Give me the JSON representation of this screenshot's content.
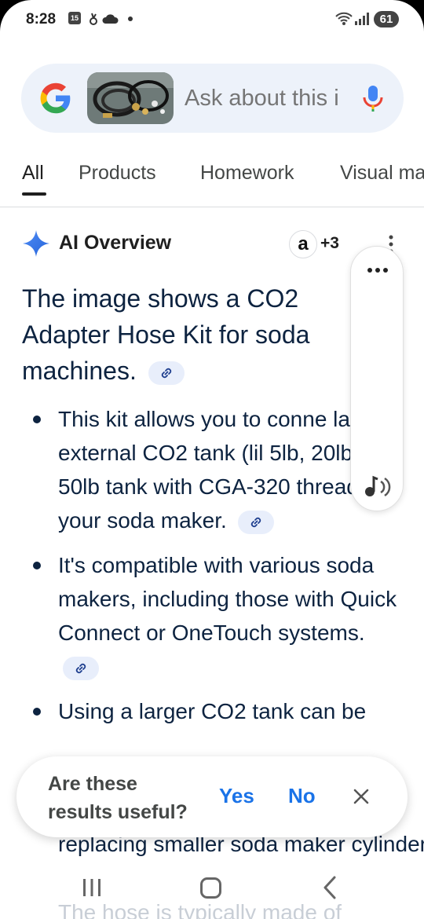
{
  "status_bar": {
    "time": "8:28",
    "calendar_day": "15",
    "battery": "61"
  },
  "search": {
    "placeholder": "Ask about this i",
    "logo": "google-g-icon",
    "mic": "mic-icon"
  },
  "tabs": [
    {
      "label": "All",
      "active": true
    },
    {
      "label": "Products"
    },
    {
      "label": "Homework"
    },
    {
      "label": "Visual ma"
    }
  ],
  "ai_overview": {
    "title": "AI Overview",
    "source_count": "+3",
    "source_icon": "a",
    "summary": "The image shows a CO2 Adapter Hose Kit for soda machines.",
    "bullets": [
      "This kit allows you to conne large, external CO2 tank (lil 5lb, 20lb, or 50lb tank with CGA-320 thread) to your soda maker.",
      "It's compatible with various soda makers, including those with Quick Connect or OneTouch systems.",
      "Using a larger CO2 tank can be",
      "replacing smaller soda maker cylinders.",
      "The hose is typically made of"
    ]
  },
  "feedback": {
    "question": "Are these results useful?",
    "yes": "Yes",
    "no": "No"
  },
  "colors": {
    "accent": "#1a73e8",
    "search_bg": "#edf2fa",
    "text_dark": "#0d2340"
  }
}
